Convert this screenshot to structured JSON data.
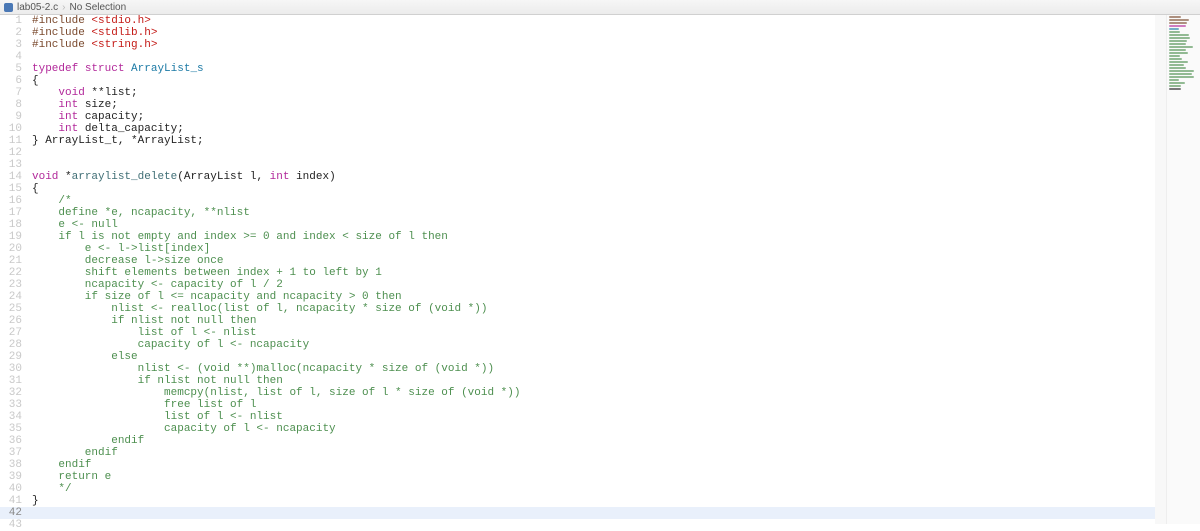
{
  "breadcrumb": {
    "filename": "lab05-2.c",
    "selection": "No Selection"
  },
  "current_line": 42,
  "code": [
    {
      "n": 1,
      "t": "pp",
      "raw": "#include <stdio.h>"
    },
    {
      "n": 2,
      "t": "pp",
      "raw": "#include <stdlib.h>"
    },
    {
      "n": 3,
      "t": "pp",
      "raw": "#include <string.h>"
    },
    {
      "n": 4,
      "t": "blank",
      "raw": ""
    },
    {
      "n": 5,
      "t": "decl",
      "raw": "typedef struct ArrayList_s"
    },
    {
      "n": 6,
      "t": "txt",
      "raw": "{"
    },
    {
      "n": 7,
      "t": "field",
      "raw": "    void **list;"
    },
    {
      "n": 8,
      "t": "field",
      "raw": "    int size;"
    },
    {
      "n": 9,
      "t": "field",
      "raw": "    int capacity;"
    },
    {
      "n": 10,
      "t": "field",
      "raw": "    int delta_capacity;"
    },
    {
      "n": 11,
      "t": "txt",
      "raw": "} ArrayList_t, *ArrayList;"
    },
    {
      "n": 12,
      "t": "blank",
      "raw": ""
    },
    {
      "n": 13,
      "t": "blank",
      "raw": ""
    },
    {
      "n": 14,
      "t": "fndecl",
      "raw": "void *arraylist_delete(ArrayList l, int index)"
    },
    {
      "n": 15,
      "t": "txt",
      "raw": "{"
    },
    {
      "n": 16,
      "t": "cm",
      "raw": "    /*"
    },
    {
      "n": 17,
      "t": "cm",
      "raw": "    define *e, ncapacity, **nlist"
    },
    {
      "n": 18,
      "t": "cm",
      "raw": "    e <- null"
    },
    {
      "n": 19,
      "t": "cm",
      "raw": "    if l is not empty and index >= 0 and index < size of l then"
    },
    {
      "n": 20,
      "t": "cm",
      "raw": "        e <- l->list[index]"
    },
    {
      "n": 21,
      "t": "cm",
      "raw": "        decrease l->size once"
    },
    {
      "n": 22,
      "t": "cm",
      "raw": "        shift elements between index + 1 to left by 1"
    },
    {
      "n": 23,
      "t": "cm",
      "raw": "        ncapacity <- capacity of l / 2"
    },
    {
      "n": 24,
      "t": "cm",
      "raw": "        if size of l <= ncapacity and ncapacity > 0 then"
    },
    {
      "n": 25,
      "t": "cm",
      "raw": "            nlist <- realloc(list of l, ncapacity * size of (void *))"
    },
    {
      "n": 26,
      "t": "cm",
      "raw": "            if nlist not null then"
    },
    {
      "n": 27,
      "t": "cm",
      "raw": "                list of l <- nlist"
    },
    {
      "n": 28,
      "t": "cm",
      "raw": "                capacity of l <- ncapacity"
    },
    {
      "n": 29,
      "t": "cm",
      "raw": "            else"
    },
    {
      "n": 30,
      "t": "cm",
      "raw": "                nlist <- (void **)malloc(ncapacity * size of (void *))"
    },
    {
      "n": 31,
      "t": "cm",
      "raw": "                if nlist not null then"
    },
    {
      "n": 32,
      "t": "cm",
      "raw": "                    memcpy(nlist, list of l, size of l * size of (void *))"
    },
    {
      "n": 33,
      "t": "cm",
      "raw": "                    free list of l"
    },
    {
      "n": 34,
      "t": "cm",
      "raw": "                    list of l <- nlist"
    },
    {
      "n": 35,
      "t": "cm",
      "raw": "                    capacity of l <- ncapacity"
    },
    {
      "n": 36,
      "t": "cm",
      "raw": "            endif"
    },
    {
      "n": 37,
      "t": "cm",
      "raw": "        endif"
    },
    {
      "n": 38,
      "t": "cm",
      "raw": "    endif"
    },
    {
      "n": 39,
      "t": "cm",
      "raw": "    return e"
    },
    {
      "n": 40,
      "t": "cm",
      "raw": "    */"
    },
    {
      "n": 41,
      "t": "txt",
      "raw": "}"
    },
    {
      "n": 42,
      "t": "blank",
      "raw": ""
    },
    {
      "n": 43,
      "t": "blank",
      "raw": ""
    }
  ],
  "minimap_colors": [
    "#7a492d",
    "#7a492d",
    "#7a492d",
    "#b2289a",
    "#1c7aa5",
    "#4d8f4f",
    "#4d8f4f",
    "#4d8f4f",
    "#4d8f4f",
    "#4d8f4f",
    "#4d8f4f",
    "#4d8f4f",
    "#4d8f4f",
    "#4d8f4f",
    "#4d8f4f",
    "#4d8f4f",
    "#4d8f4f",
    "#4d8f4f",
    "#4d8f4f",
    "#4d8f4f",
    "#4d8f4f",
    "#4d8f4f",
    "#4d8f4f",
    "#4d8f4f",
    "#222"
  ]
}
